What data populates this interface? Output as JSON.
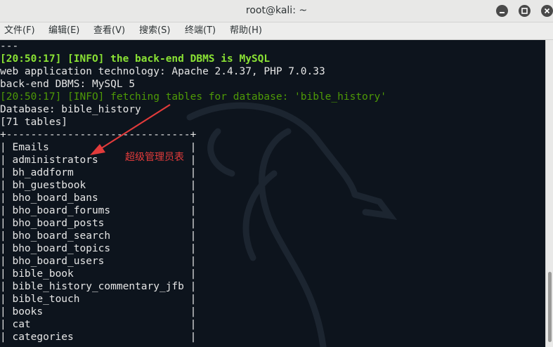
{
  "window": {
    "title": "root@kali: ~"
  },
  "menu": [
    {
      "label": "文件(F)"
    },
    {
      "label": "编辑(E)"
    },
    {
      "label": "查看(V)"
    },
    {
      "label": "搜索(S)"
    },
    {
      "label": "终端(T)"
    },
    {
      "label": "帮助(H)"
    }
  ],
  "terminal": {
    "lines": [
      {
        "text": "---",
        "style": "white"
      },
      {
        "text": "[20:50:17] [INFO] the back-end DBMS is MySQL",
        "style": "bold-green"
      },
      {
        "text": "web application technology: Apache 2.4.37, PHP 7.0.33",
        "style": "white"
      },
      {
        "text": "back-end DBMS: MySQL 5",
        "style": "white"
      },
      {
        "text": "[20:50:17] [INFO] fetching tables for database: 'bible_history'",
        "style": "dim-green"
      },
      {
        "text": "Database: bible_history",
        "style": "white"
      },
      {
        "text": "[71 tables]",
        "style": "white"
      },
      {
        "text": "+------------------------------+",
        "style": "white"
      },
      {
        "text": "| Emails                       |",
        "style": "white"
      },
      {
        "text": "| administrators               |",
        "style": "white"
      },
      {
        "text": "| bh_addform                   |",
        "style": "white"
      },
      {
        "text": "| bh_guestbook                 |",
        "style": "white"
      },
      {
        "text": "| bho_board_bans               |",
        "style": "white"
      },
      {
        "text": "| bho_board_forums             |",
        "style": "white"
      },
      {
        "text": "| bho_board_posts              |",
        "style": "white"
      },
      {
        "text": "| bho_board_search             |",
        "style": "white"
      },
      {
        "text": "| bho_board_topics             |",
        "style": "white"
      },
      {
        "text": "| bho_board_users              |",
        "style": "white"
      },
      {
        "text": "| bible_book                   |",
        "style": "white"
      },
      {
        "text": "| bible_history_commentary_jfb |",
        "style": "white"
      },
      {
        "text": "| bible_touch                  |",
        "style": "white"
      },
      {
        "text": "| books                        |",
        "style": "white"
      },
      {
        "text": "| cat                          |",
        "style": "white"
      },
      {
        "text": "| categories                   |",
        "style": "white"
      }
    ]
  },
  "annotation": {
    "text": "超级管理员表",
    "color": "#e23b3b"
  },
  "colors": {
    "terminal_bg": "#0d141d",
    "info_bold": "#8ae234",
    "info_dim": "#4e9a06",
    "text": "#e6e6e6"
  }
}
